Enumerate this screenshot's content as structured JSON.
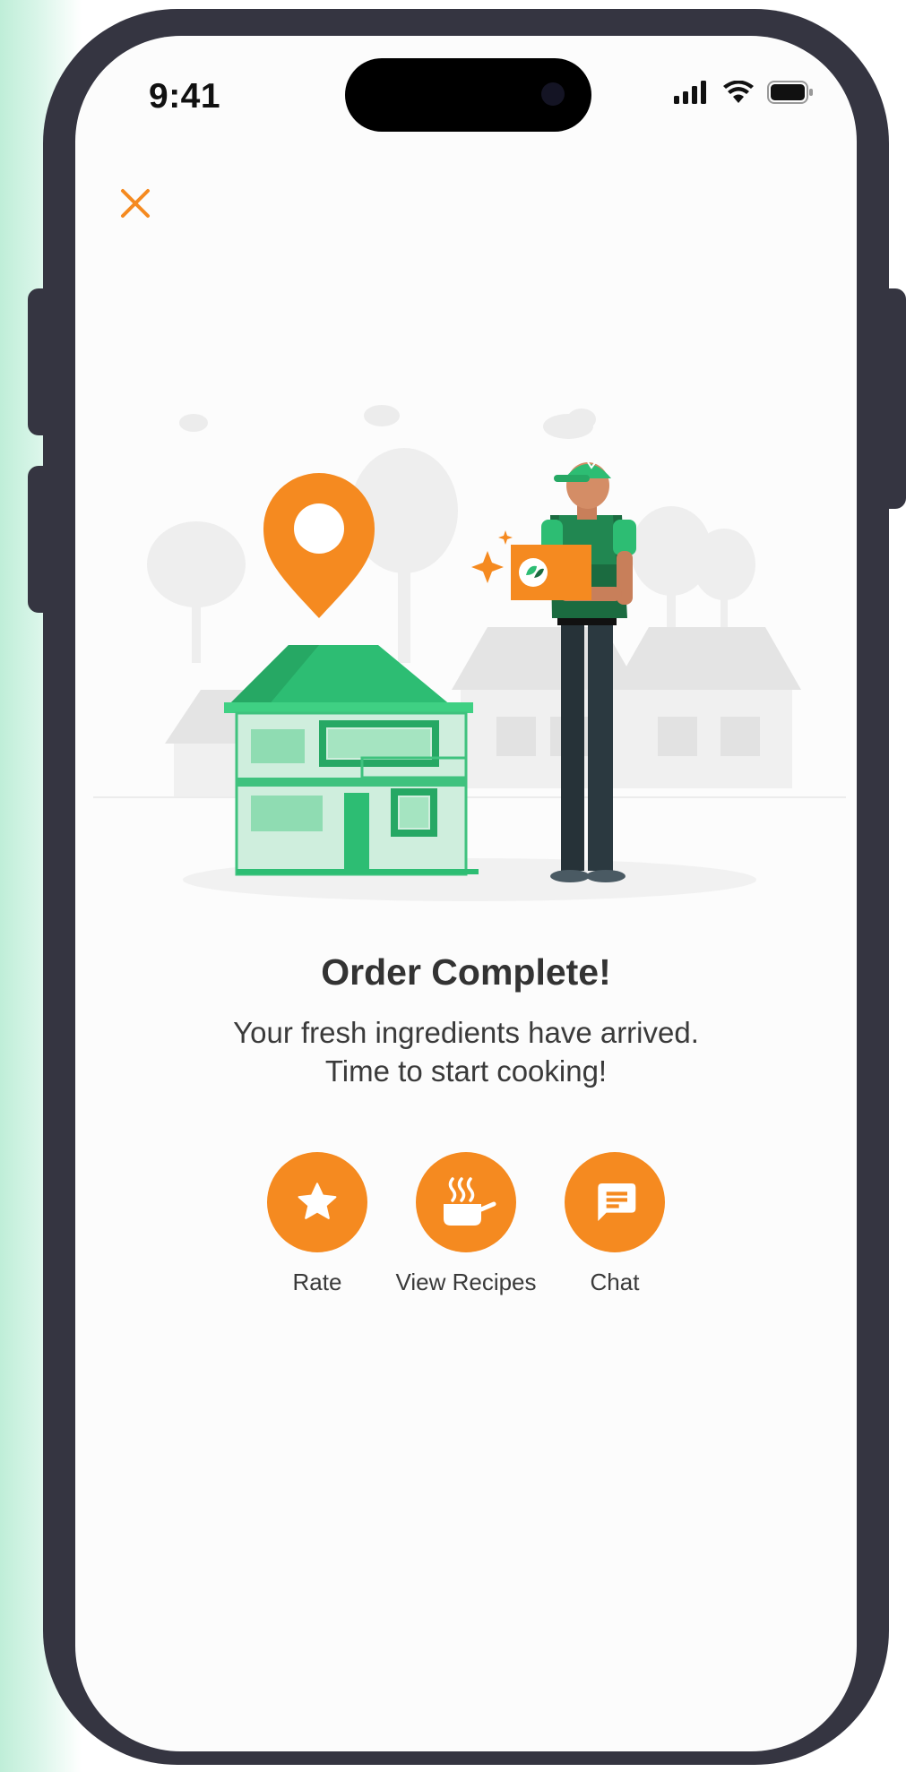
{
  "status_bar": {
    "time": "9:41"
  },
  "close_icon": "close-icon",
  "order": {
    "title": "Order Complete!",
    "message_line1": "Your fresh ingredients have arrived.",
    "message_line2": "Time to start cooking!"
  },
  "actions": [
    {
      "label": "Rate",
      "icon": "star-icon"
    },
    {
      "label": "View Recipes",
      "icon": "cooking-pot-icon"
    },
    {
      "label": "Chat",
      "icon": "chat-bubble-icon"
    }
  ],
  "colors": {
    "accent": "#f58a20",
    "house_green": "#2dbd73",
    "frame": "#353541",
    "text": "#333333"
  }
}
